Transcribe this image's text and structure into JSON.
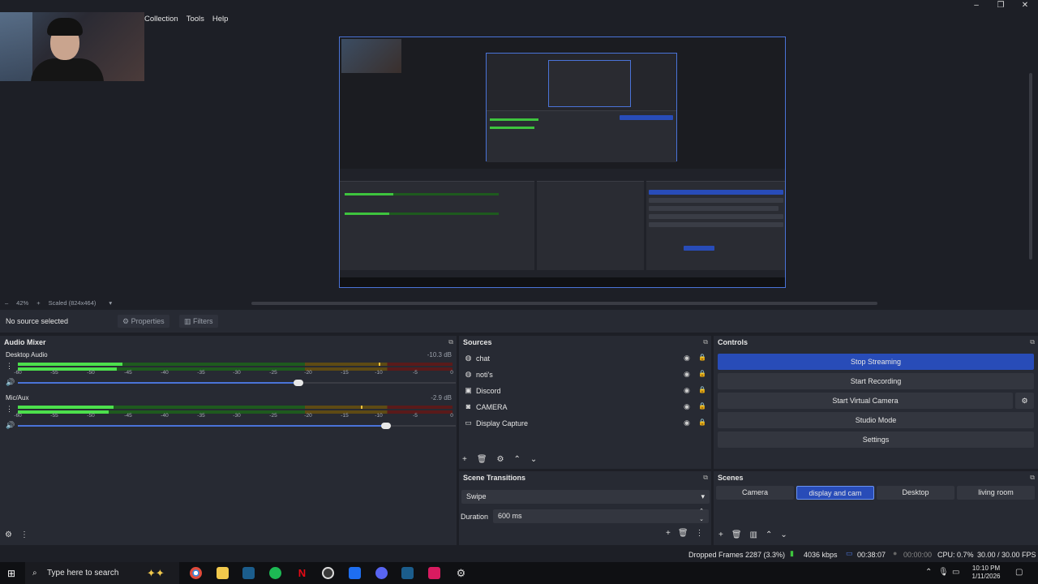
{
  "menubar": [
    "Collection",
    "Tools",
    "Help"
  ],
  "window_controls": {
    "minimize": "–",
    "maximize": "❐",
    "close": "✕"
  },
  "preview": {
    "zoom": "42%",
    "scale_label": "Scaled (824x464)"
  },
  "source_toolbar": {
    "selection": "No source selected",
    "properties": "Properties",
    "filters": "Filters"
  },
  "audio_mixer": {
    "title": "Audio Mixer",
    "channels": [
      {
        "name": "Desktop Audio",
        "db": "-10.3 dB",
        "level": 0.24,
        "peak": 0.83,
        "volume": 0.64
      },
      {
        "name": "Mic/Aux",
        "db": "-2.9 dB",
        "level": 0.22,
        "peak": 0.79,
        "volume": 0.84
      }
    ],
    "ticks": [
      "-60",
      "-55",
      "-50",
      "-45",
      "-40",
      "-35",
      "-30",
      "-25",
      "-20",
      "-15",
      "-10",
      "-5",
      "0"
    ]
  },
  "sources": {
    "title": "Sources",
    "items": [
      {
        "label": "chat",
        "icon": "globe-icon"
      },
      {
        "label": "noti's",
        "icon": "globe-icon"
      },
      {
        "label": "Discord",
        "icon": "window-icon"
      },
      {
        "label": "CAMERA",
        "icon": "camera-icon"
      },
      {
        "label": "Display Capture",
        "icon": "monitor-icon"
      }
    ]
  },
  "controls": {
    "title": "Controls",
    "stop_streaming": "Stop Streaming",
    "start_recording": "Start Recording",
    "start_virtual_camera": "Start Virtual Camera",
    "studio_mode": "Studio Mode",
    "settings": "Settings"
  },
  "scene_transitions": {
    "title": "Scene Transitions",
    "transition": "Swipe",
    "duration_label": "Duration",
    "duration": "600 ms"
  },
  "scenes": {
    "title": "Scenes",
    "items": [
      {
        "label": "Camera",
        "active": false
      },
      {
        "label": "display and cam",
        "active": true
      },
      {
        "label": "Desktop",
        "active": false
      },
      {
        "label": "living room",
        "active": false
      }
    ]
  },
  "status": {
    "dropped_frames": "Dropped Frames 2287 (3.3%)",
    "bitrate": "4036 kbps",
    "stream_time": "00:38:07",
    "record_time": "00:00:00",
    "cpu": "CPU: 0.7%",
    "fps": "30.00 / 30.00 FPS"
  },
  "taskbar": {
    "search_placeholder": "Type here to search",
    "time": "10:10 PM",
    "date": "1/11/2026"
  },
  "colors": {
    "accent": "#284cb8",
    "panel": "#272a33",
    "background": "#1d1f26"
  }
}
